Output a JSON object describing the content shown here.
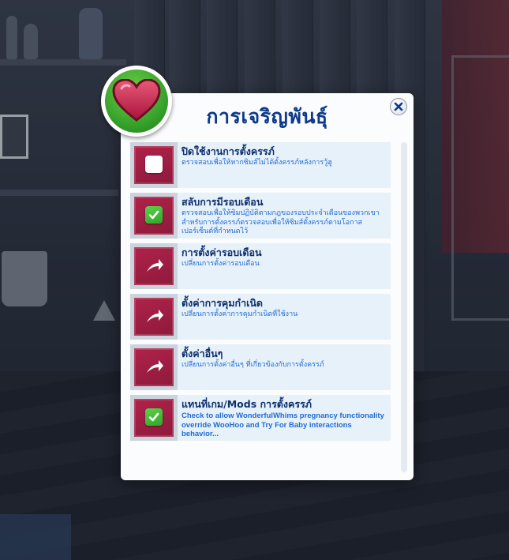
{
  "dialog": {
    "title": "การเจริญพันธุ์"
  },
  "colors": {
    "title": "#0d3a8a",
    "row_bg": "#e7f1f9",
    "tile_crimson": "#a01f44",
    "check_green": "#3cb532",
    "desc_blue": "#1f6bd6"
  },
  "items": [
    {
      "title": "ปิดใช้งานการตั้งครรภ์",
      "desc": "ตรวจสอบเพื่อให้หากซิมส์ไม่ได้ตั้งครรภ์หลังการวู้ฮู",
      "icon": "checkbox-unchecked-icon"
    },
    {
      "title": "สลับการมีรอบเดือน",
      "desc": "ตรวจสอบเพื่อให้ซิมปฏิบัติตามกฎของรอบประจำเดือนของพวกเขาสำหรับการตั้งครรภ์ตรวจสอบเพื่อให้ซิมส์ตั้งครรภ์ตามโอกาสเปอร์เซ็นต์ที่กำหนดไว้",
      "icon": "checkbox-checked-icon"
    },
    {
      "title": "การตั้งค่ารอบเดือน",
      "desc": "เปลี่ยนการตั้งค่ารอบเดือน",
      "icon": "curved-arrow-icon"
    },
    {
      "title": "ตั้งค่าการคุมกำเนิด",
      "desc": "เปลี่ยนการตั้งค่าการคุมกำเนิดที่ใช้งาน",
      "icon": "curved-arrow-icon"
    },
    {
      "title": "ตั้งค่าอื่นๆ",
      "desc": "เปลี่ยนการตั้งค่าอื่นๆ ที่เกี่ยวข้องกับการตั้งครรภ์",
      "icon": "curved-arrow-icon"
    },
    {
      "title": "แทนที่เกม/Mods การตั้งครรภ์",
      "desc": "Check to allow WonderfulWhims pregnancy functionality override WooHoo and Try For Baby interactions behavior...",
      "icon": "checkbox-checked-icon"
    }
  ]
}
